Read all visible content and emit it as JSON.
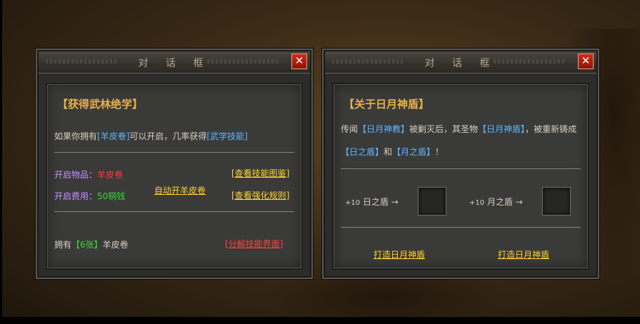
{
  "dialog1": {
    "title": "对 话 框",
    "close": "✕",
    "heading": "【获得武林绝学】",
    "desc": {
      "p1": "如果你拥有",
      "item": "[羊皮卷]",
      "p2": "可以开启，几率获得",
      "skill": "[武学技能]"
    },
    "open_item_label": "开启物品：",
    "open_item_value": "羊皮卷",
    "open_cost_label": "开启费用：",
    "open_cost_value": "50铜钱",
    "auto_open": "自动开羊皮卷",
    "view_skill_guide": "[查看技能图鉴]",
    "view_enhance_rules": "[查看强化规则]",
    "own_prefix": "拥有",
    "own_count": "【6张】",
    "own_suffix": "羊皮卷",
    "decompose": "[分解技能界面]"
  },
  "dialog2": {
    "title": "对 话 框",
    "close": "✕",
    "heading": "【关于日月神盾】",
    "line1": {
      "p1": "传闻",
      "cult": "【日月神教】",
      "p2": "被剿灭后，其圣物",
      "shield": "【日月神盾】",
      "p3": "，被重新铸成"
    },
    "line2": {
      "sun": "【日之盾】",
      "and": "和",
      "moon": "【月之盾】",
      "end": "！"
    },
    "sun_shield": {
      "prefix": "+10",
      "name": "日之盾",
      "arrow": "→"
    },
    "moon_shield": {
      "prefix": "+10",
      "name": "月之盾",
      "arrow": "→"
    },
    "forge_left": "打造日月神盾",
    "forge_right": "打造日月神盾"
  },
  "colors": {
    "heading": "#e6b24a",
    "link_yellow": "#ffd232",
    "link_red": "#ff4040",
    "blue": "#5fb6ff",
    "green": "#38d838",
    "red": "#ff3b3b",
    "purple": "#c590ff"
  }
}
